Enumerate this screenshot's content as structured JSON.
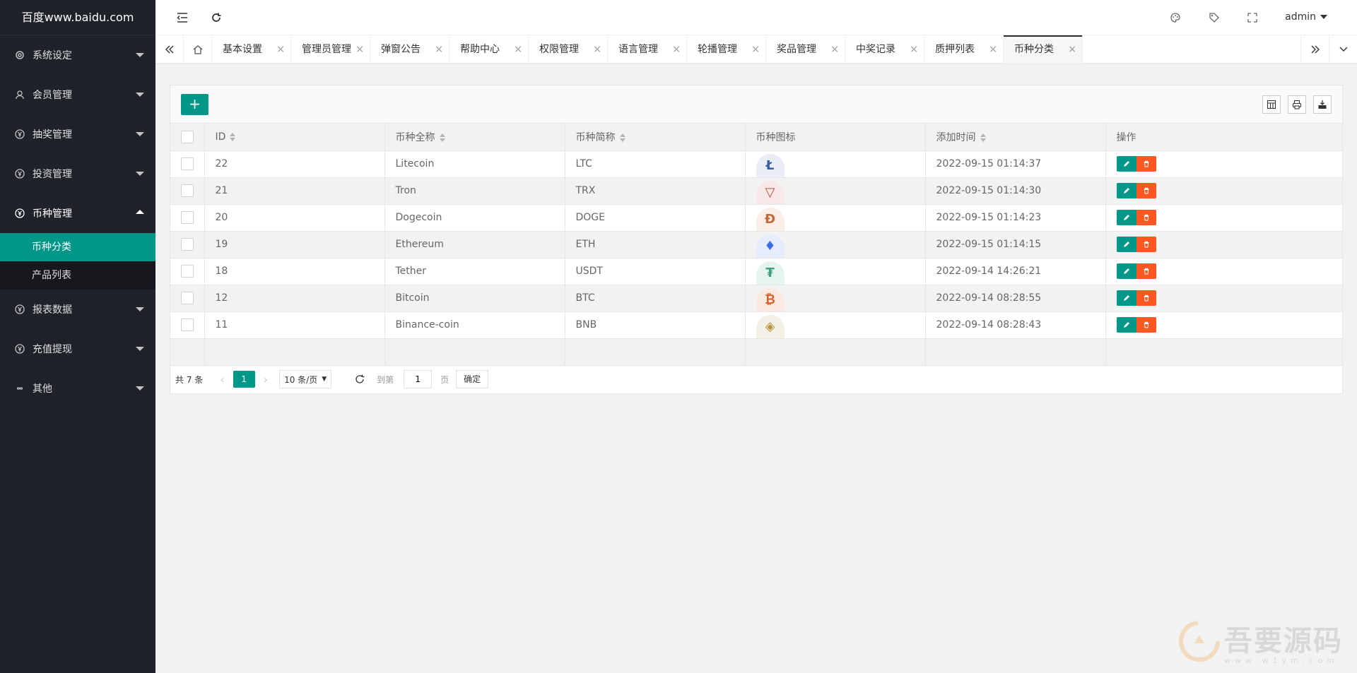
{
  "app": {
    "logo": "百度www.baidu.com",
    "user": "admin"
  },
  "sidebar": {
    "items": [
      {
        "label": "系统设定"
      },
      {
        "label": "会员管理"
      },
      {
        "label": "抽奖管理"
      },
      {
        "label": "投资管理"
      },
      {
        "label": "币种管理",
        "children": [
          {
            "label": "币种分类"
          },
          {
            "label": "产品列表"
          }
        ]
      },
      {
        "label": "报表数据"
      },
      {
        "label": "充值提现"
      },
      {
        "label": "其他"
      }
    ]
  },
  "tabs": [
    "基本设置",
    "管理员管理",
    "弹窗公告",
    "帮助中心",
    "权限管理",
    "语言管理",
    "轮播管理",
    "奖品管理",
    "中奖记录",
    "质押列表",
    "币种分类"
  ],
  "tab_close": "×",
  "toolbar": {
    "add": "+"
  },
  "table": {
    "headers": [
      "ID",
      "币种全称",
      "币种简称",
      "币种图标",
      "添加时间",
      "操作"
    ],
    "rows": [
      {
        "id": "22",
        "name": "Litecoin",
        "symbol": "LTC",
        "time": "2022-09-15 01:14:37",
        "icon": "Ł",
        "color": "#345d9d",
        "bg": "#e8edf6"
      },
      {
        "id": "21",
        "name": "Tron",
        "symbol": "TRX",
        "time": "2022-09-15 01:14:30",
        "icon": "▽",
        "color": "#c4493f",
        "bg": "#f8e9e8"
      },
      {
        "id": "20",
        "name": "Dogecoin",
        "symbol": "DOGE",
        "time": "2022-09-15 01:14:23",
        "icon": "Đ",
        "color": "#c26a3b",
        "bg": "#faeee7"
      },
      {
        "id": "19",
        "name": "Ethereum",
        "symbol": "ETH",
        "time": "2022-09-15 01:14:15",
        "icon": "♦",
        "color": "#3c6fe6",
        "bg": "#e6ecfb"
      },
      {
        "id": "18",
        "name": "Tether",
        "symbol": "USDT",
        "time": "2022-09-14 14:26:21",
        "icon": "₮",
        "color": "#3aa37c",
        "bg": "#e6f4ee"
      },
      {
        "id": "12",
        "name": "Bitcoin",
        "symbol": "BTC",
        "time": "2022-09-14 08:28:55",
        "icon": "₿",
        "color": "#d9602b",
        "bg": "#f9e9e1"
      },
      {
        "id": "11",
        "name": "Binance-coin",
        "symbol": "BNB",
        "time": "2022-09-14 08:28:43",
        "icon": "◈",
        "color": "#b8923a",
        "bg": "#f3f0e6"
      }
    ]
  },
  "pager": {
    "count": "共 7 条",
    "current": "1",
    "per_page": "10 条/页",
    "goto": "到第",
    "page_value": "1",
    "page_unit": "页",
    "confirm": "确定"
  },
  "watermark": {
    "title": "吾要源码",
    "sub": "www.w1ym.com"
  },
  "colors": {
    "accent": "#009688",
    "danger": "#ff5722",
    "sidebar": "#20222a"
  }
}
